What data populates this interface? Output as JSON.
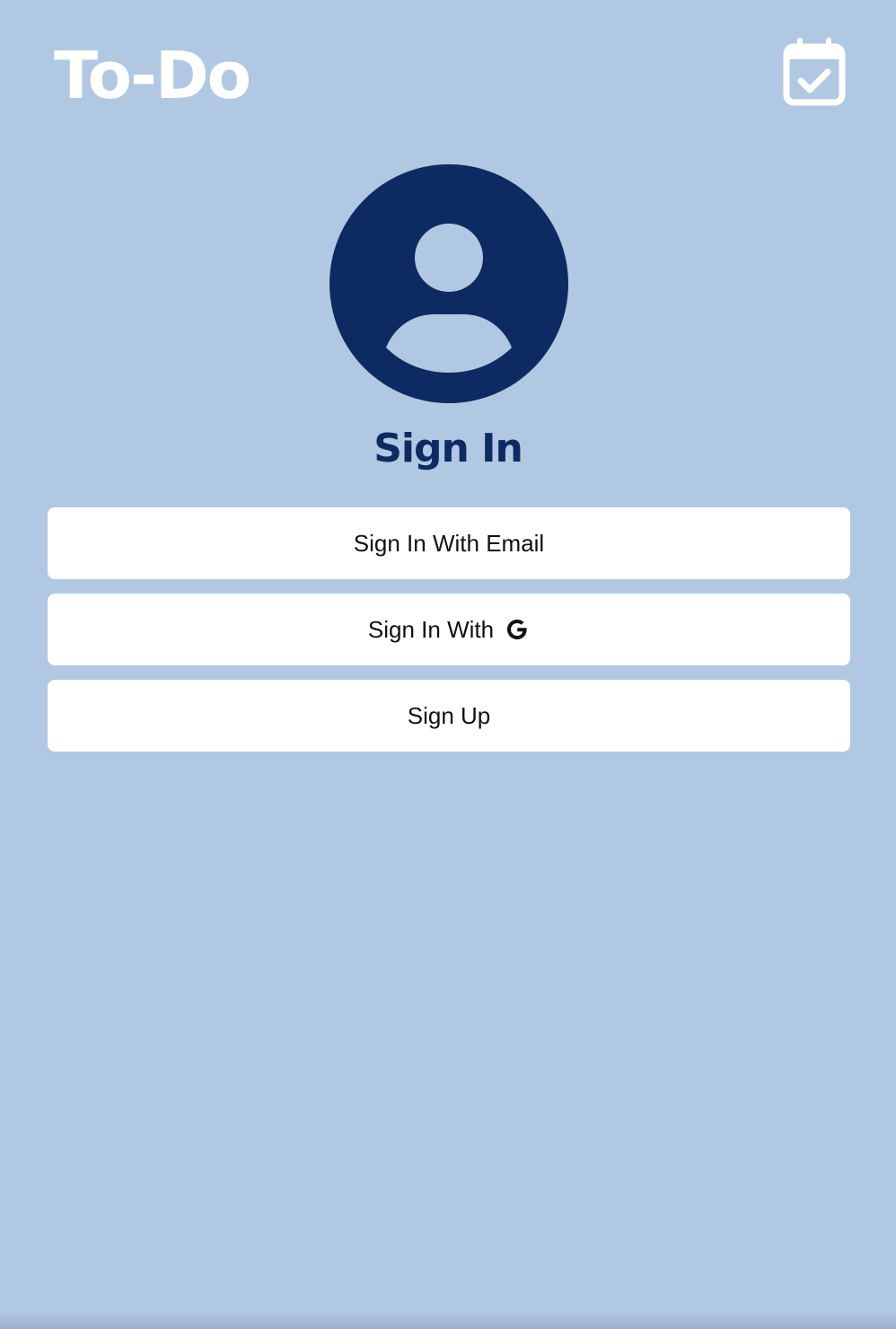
{
  "header": {
    "title": "To-Do",
    "calendar_icon": "calendar-check-icon"
  },
  "auth": {
    "avatar_icon": "user-circle-icon",
    "heading": "Sign In",
    "email_button_label": "Sign In With Email",
    "google_button_label": "Sign In With",
    "google_icon": "google-g-icon",
    "signup_button_label": "Sign Up"
  },
  "colors": {
    "background": "#b1c8e2",
    "primary_navy": "#0e2a62",
    "button_bg": "#ffffff",
    "title_text": "#ffffff"
  }
}
